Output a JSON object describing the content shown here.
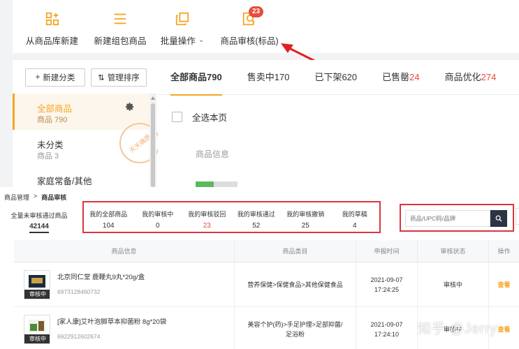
{
  "toolbar": {
    "items": [
      {
        "label": "从商品库新建",
        "icon": "add-grid-icon"
      },
      {
        "label": "新建组包商品",
        "icon": "list-icon"
      },
      {
        "label": "批量操作",
        "icon": "copy-icon",
        "caret": "⌄"
      },
      {
        "label": "商品审核(标品)",
        "icon": "search-doc-icon",
        "badge": "23"
      }
    ]
  },
  "sidebar": {
    "new_category": "新建分类",
    "manage_sort": "管理排序",
    "categories": [
      {
        "name": "全部商品",
        "count": "商品 790"
      },
      {
        "name": "未分类",
        "count": "商品 3"
      },
      {
        "name": "家庭常备/其他",
        "count": ""
      }
    ],
    "stamp": "天天确质"
  },
  "tabs": [
    {
      "label": "全部商品",
      "num": "790"
    },
    {
      "label": "售卖中",
      "num": "170"
    },
    {
      "label": "已下架",
      "num": "620"
    },
    {
      "label": "已售罄",
      "num": "24"
    },
    {
      "label": "商品优化",
      "num": "274"
    }
  ],
  "main": {
    "select_all": "全选本页",
    "product_info": "商品信息"
  },
  "audit": {
    "breadcrumb": [
      "商品管理",
      ">",
      "商品审核"
    ],
    "first_stat": {
      "label": "全量未审核通过商品",
      "value": "42144"
    },
    "stats": [
      {
        "label": "我的全部商品",
        "value": "104"
      },
      {
        "label": "我的审核中",
        "value": "0"
      },
      {
        "label": "我的审核驳回",
        "value": "23"
      },
      {
        "label": "我的审核通过",
        "value": "52"
      },
      {
        "label": "我的审核撤销",
        "value": "25"
      },
      {
        "label": "我的草稿",
        "value": "4"
      }
    ],
    "search_placeholder": "商品/UPC码/品牌",
    "columns": [
      "商品信息",
      "商品类目",
      "申报时间",
      "审核状态",
      "操作"
    ],
    "rows": [
      {
        "tag": "审核中",
        "name": "北京同仁堂 鹿鞭丸9丸*20g/盒",
        "code": "6973128460732",
        "category": "营养保健>保健食品>其他保健食品",
        "date": "2021-09-07",
        "time": "17:24:25",
        "status": "审核中",
        "action": "查看"
      },
      {
        "tag": "审核中",
        "name": "[家人康]艾叶泡脚草本抑菌粉 8g*20袋",
        "code": "6922912602674",
        "category": "美容个护(药)>手足护理>足部抑菌/足浴粉",
        "date": "2021-09-07",
        "time": "17:24:10",
        "status": "审核中",
        "action": "查看"
      }
    ]
  },
  "watermark": "知乎 @Jerry",
  "colors": {
    "accent": "#f5a623",
    "red": "#e74c3c",
    "highlight": "#d9363e"
  }
}
